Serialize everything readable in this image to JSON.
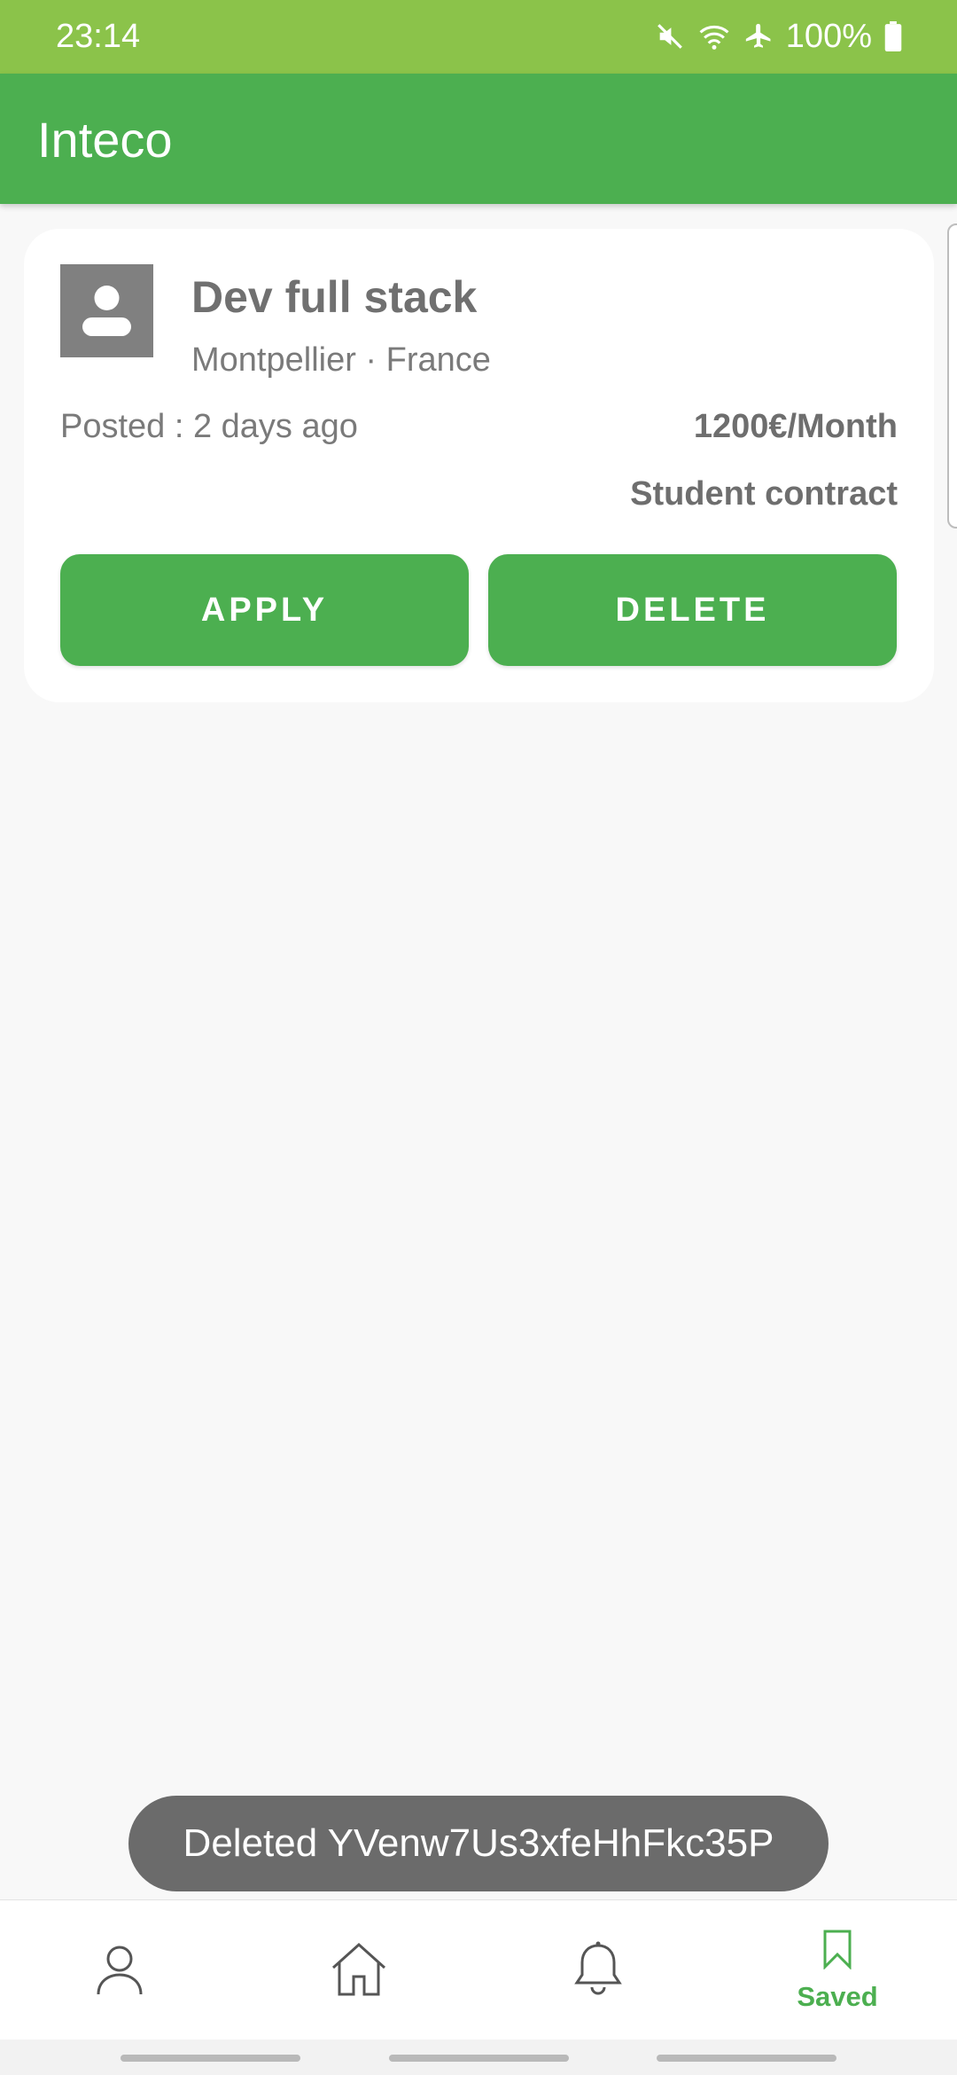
{
  "status_bar": {
    "time": "23:14",
    "battery": "100%",
    "icons": [
      "mute-icon",
      "wifi-icon",
      "airplane-icon",
      "battery-icon"
    ]
  },
  "app_bar": {
    "title": "Inteco"
  },
  "job_card": {
    "title": "Dev full stack",
    "location": "Montpellier · France",
    "posted": "Posted : 2 days ago",
    "salary": "1200€/Month",
    "contract": "Student contract",
    "apply_label": "APPLY",
    "delete_label": "DELETE",
    "avatar_icon": "person-placeholder-icon"
  },
  "toast": {
    "message": "Deleted YVenw7Us3xfeHhFkc35P"
  },
  "bottom_nav": {
    "items": [
      {
        "icon": "person-icon",
        "label": ""
      },
      {
        "icon": "home-icon",
        "label": ""
      },
      {
        "icon": "bell-icon",
        "label": ""
      },
      {
        "icon": "bookmark-icon",
        "label": "Saved",
        "active": true
      }
    ]
  },
  "colors": {
    "status_bar": "#8bc34a",
    "primary": "#4caf50",
    "background": "#f8f8f8",
    "toast": "#6b6b6b"
  }
}
